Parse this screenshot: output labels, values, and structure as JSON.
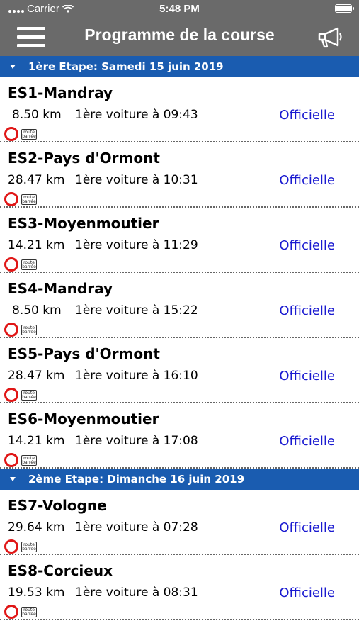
{
  "status_bar": {
    "carrier": "Carrier",
    "time": "5:48 PM"
  },
  "nav": {
    "title": "Programme de la course"
  },
  "sections": [
    {
      "header": "1ère Etape: Samedi 15 juin 2019",
      "stages": [
        {
          "name": "ES1-Mandray",
          "distance": "8.50 km",
          "first_car": "1ère voiture à 09:43",
          "status": "Officielle",
          "road_label_1": "route",
          "road_label_2": "barrée"
        },
        {
          "name": "ES2-Pays d'Ormont",
          "distance": "28.47 km",
          "first_car": "1ère voiture à 10:31",
          "status": "Officielle",
          "road_label_1": "route",
          "road_label_2": "barrée"
        },
        {
          "name": "ES3-Moyenmoutier",
          "distance": "14.21 km",
          "first_car": "1ère voiture à 11:29",
          "status": "Officielle",
          "road_label_1": "route",
          "road_label_2": "barrée"
        },
        {
          "name": "ES4-Mandray",
          "distance": "8.50 km",
          "first_car": "1ère voiture à 15:22",
          "status": "Officielle",
          "road_label_1": "route",
          "road_label_2": "barrée"
        },
        {
          "name": "ES5-Pays d'Ormont",
          "distance": "28.47 km",
          "first_car": "1ère voiture à 16:10",
          "status": "Officielle",
          "road_label_1": "route",
          "road_label_2": "barrée"
        },
        {
          "name": "ES6-Moyenmoutier",
          "distance": "14.21 km",
          "first_car": "1ère voiture à 17:08",
          "status": "Officielle",
          "road_label_1": "route",
          "road_label_2": "barrée"
        }
      ]
    },
    {
      "header": "2ème Etape: Dimanche 16 juin 2019",
      "stages": [
        {
          "name": "ES7-Vologne",
          "distance": "29.64 km",
          "first_car": "1ère voiture à 07:28",
          "status": "Officielle",
          "road_label_1": "route",
          "road_label_2": "barrée"
        },
        {
          "name": "ES8-Corcieux",
          "distance": "19.53 km",
          "first_car": "1ère voiture à 08:31",
          "status": "Officielle",
          "road_label_1": "route",
          "road_label_2": "barrée"
        }
      ]
    }
  ],
  "icons": {
    "menu": "hamburger-menu-icon",
    "announce": "megaphone-icon",
    "closed_ring": "red-ring-icon",
    "road_closed": "route-barree-sign-icon"
  },
  "colors": {
    "nav_bg": "#6a6a6a",
    "section_bg": "#1a5cb0",
    "status_link": "#1a1ad0",
    "ring": "#e01616"
  }
}
